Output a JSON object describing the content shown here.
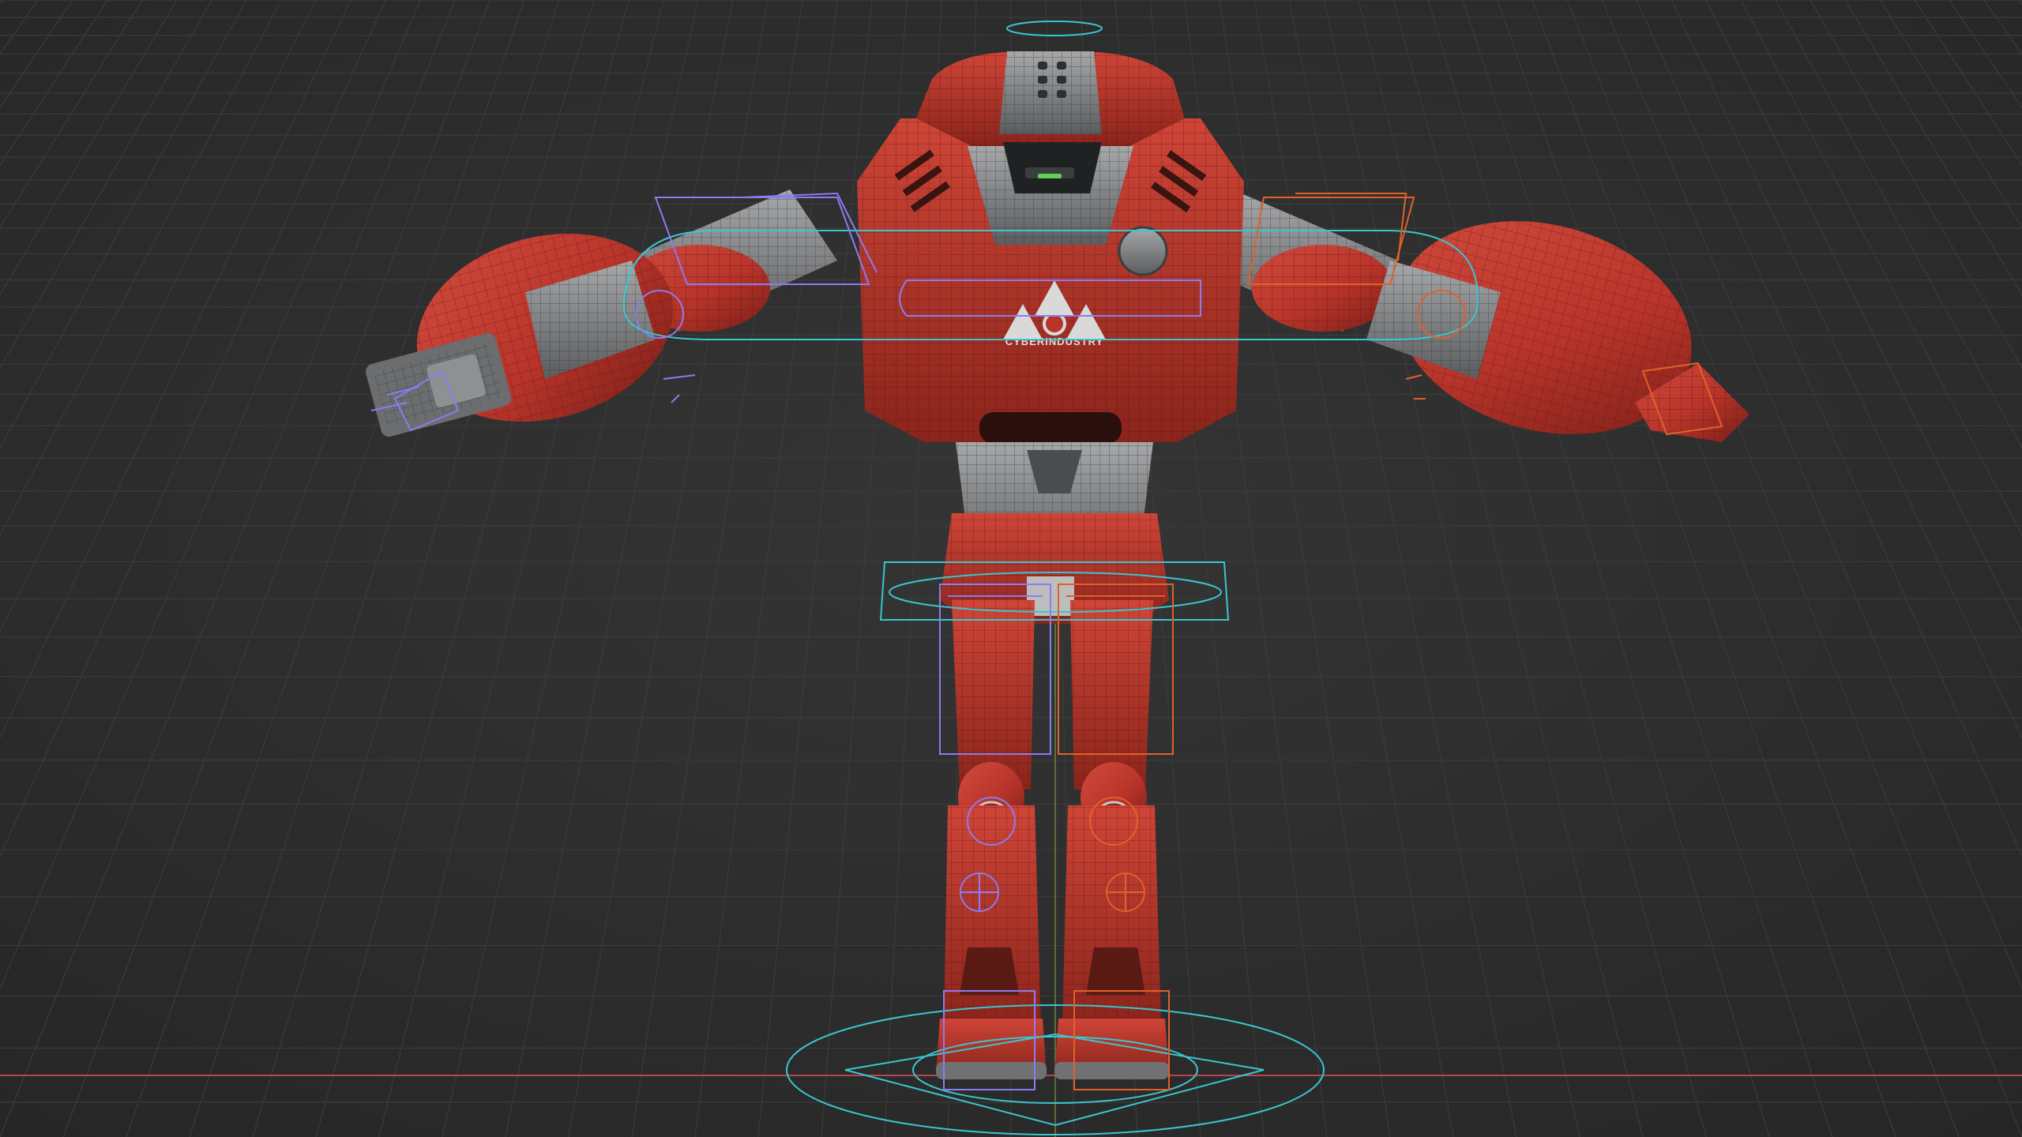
{
  "viewport": {
    "background": "#2b2b2b",
    "grid_color": "#3a3a3a",
    "x_axis_color": "#b8454f",
    "z_axis_color": "#7fae3e"
  },
  "model": {
    "decal_text": "CYBERINDUSTRY",
    "armor_color": "#b8342a",
    "armor_dark": "#7a1f18",
    "metal_color": "#6f7173",
    "metal_light": "#a6a8aa",
    "wire_color": "#4a1410"
  },
  "rig": {
    "root_color": "#3ac6cf",
    "left_side_color": "#8b7cf0",
    "right_side_color": "#e0612a"
  }
}
